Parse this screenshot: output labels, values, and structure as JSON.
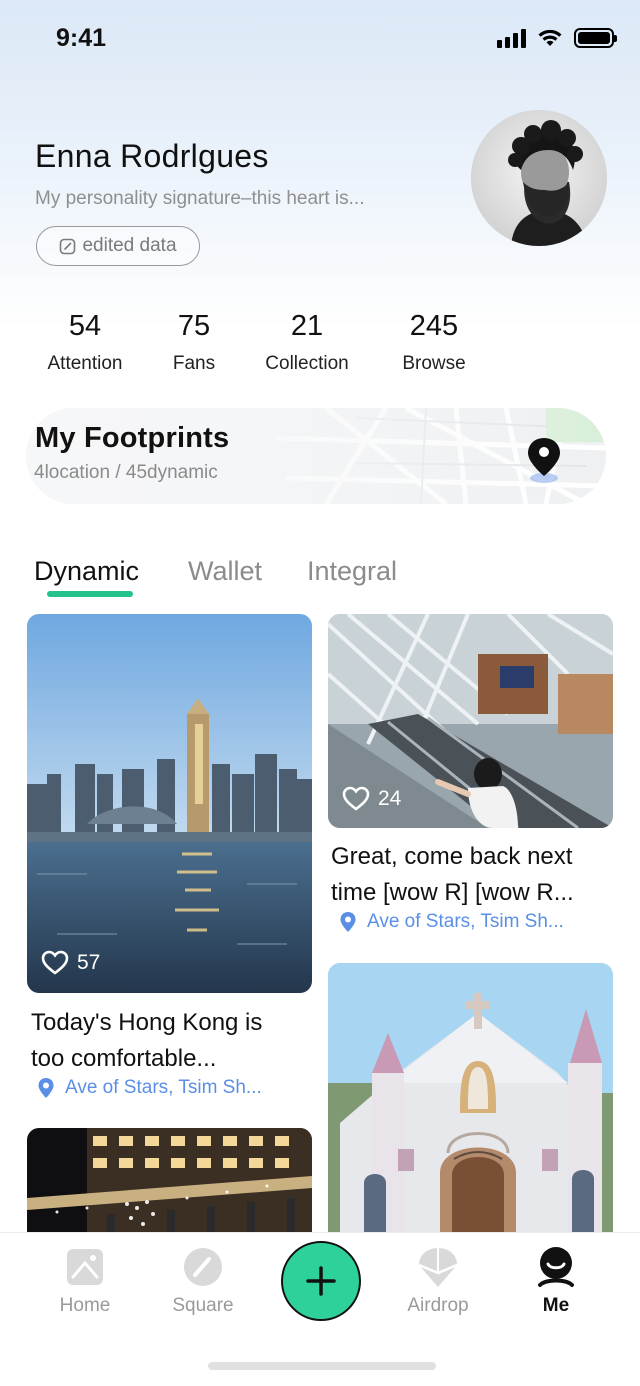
{
  "status_bar": {
    "time": "9:41"
  },
  "profile": {
    "name": "Enna Rodrlgues",
    "signature": "My personality signature–this heart is...",
    "edit_label": "edited data"
  },
  "stats": [
    {
      "value": "54",
      "label": "Attention"
    },
    {
      "value": "75",
      "label": "Fans"
    },
    {
      "value": "21",
      "label": "Collection"
    },
    {
      "value": "245",
      "label": "Browse"
    }
  ],
  "footprints": {
    "title": "My Footprints",
    "subtitle": "4location / 45dynamic"
  },
  "tabs": [
    {
      "label": "Dynamic",
      "active": true
    },
    {
      "label": "Wallet",
      "active": false
    },
    {
      "label": "Integral",
      "active": false
    }
  ],
  "posts": [
    {
      "likes": "57",
      "text_line1": "Today's Hong Kong is",
      "text_line2": "too comfortable...",
      "location": "Ave of Stars, Tsim Sh..."
    },
    {
      "likes": "24",
      "text_line1": "Great, come back next",
      "text_line2": "time [wow R] [wow R...",
      "location": "Ave of Stars, Tsim Sh..."
    }
  ],
  "nav": [
    {
      "label": "Home",
      "icon": "home-icon"
    },
    {
      "label": "Square",
      "icon": "compass-icon"
    },
    {
      "label": "",
      "icon": "plus-icon"
    },
    {
      "label": "Airdrop",
      "icon": "parachute-icon"
    },
    {
      "label": "Me",
      "icon": "user-icon"
    }
  ],
  "colors": {
    "accent": "#22c28a",
    "fab": "#2fd19a",
    "location": "#5b8fe6",
    "muted": "#8b8b8b"
  }
}
